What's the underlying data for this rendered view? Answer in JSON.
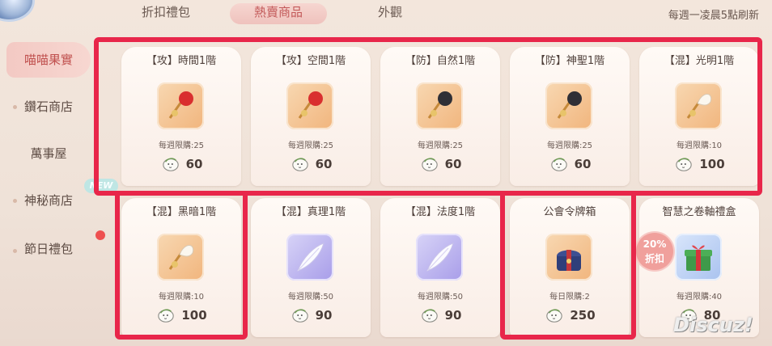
{
  "top_tabs": [
    "折扣禮包",
    "熱賣商品",
    "外觀"
  ],
  "refresh_text": "每週一凌晨5點刷新",
  "sidebar": {
    "items": [
      "喵喵果實",
      "鑽石商店",
      "萬事屋",
      "神秘商店",
      "節日禮包"
    ],
    "new_badge": "NEW"
  },
  "cards": [
    {
      "title": "【攻】時間1階",
      "limit": "每週限購:25",
      "price": "60",
      "item_icon": "feather-red"
    },
    {
      "title": "【攻】空間1階",
      "limit": "每週限購:25",
      "price": "60",
      "item_icon": "feather-red"
    },
    {
      "title": "【防】自然1階",
      "limit": "每週限購:25",
      "price": "60",
      "item_icon": "feather-black"
    },
    {
      "title": "【防】神聖1階",
      "limit": "每週限購:25",
      "price": "60",
      "item_icon": "feather-black"
    },
    {
      "title": "【混】光明1階",
      "limit": "每週限購:10",
      "price": "100",
      "item_icon": "feather-white"
    },
    {
      "title": "【混】黑暗1階",
      "limit": "每週限購:10",
      "price": "100",
      "item_icon": "feather-white"
    },
    {
      "title": "【混】真理1階",
      "limit": "每週限購:50",
      "price": "90",
      "item_icon": "quill"
    },
    {
      "title": "【混】法度1階",
      "limit": "每週限購:50",
      "price": "90",
      "item_icon": "quill"
    },
    {
      "title": "公會令牌箱",
      "limit": "每日限購:2",
      "price": "250",
      "item_icon": "token-chest"
    },
    {
      "title": "智慧之卷軸禮盒",
      "limit": "每週限購:40",
      "price": "80",
      "item_icon": "gift-box"
    }
  ],
  "discount_badge": {
    "percent": "20%",
    "label": "折扣"
  },
  "watermark": "Discuz!",
  "colors": {
    "highlight": "#e8264a",
    "active_tab": "#c35a5a",
    "accent_pink": "#f3c9c3"
  }
}
